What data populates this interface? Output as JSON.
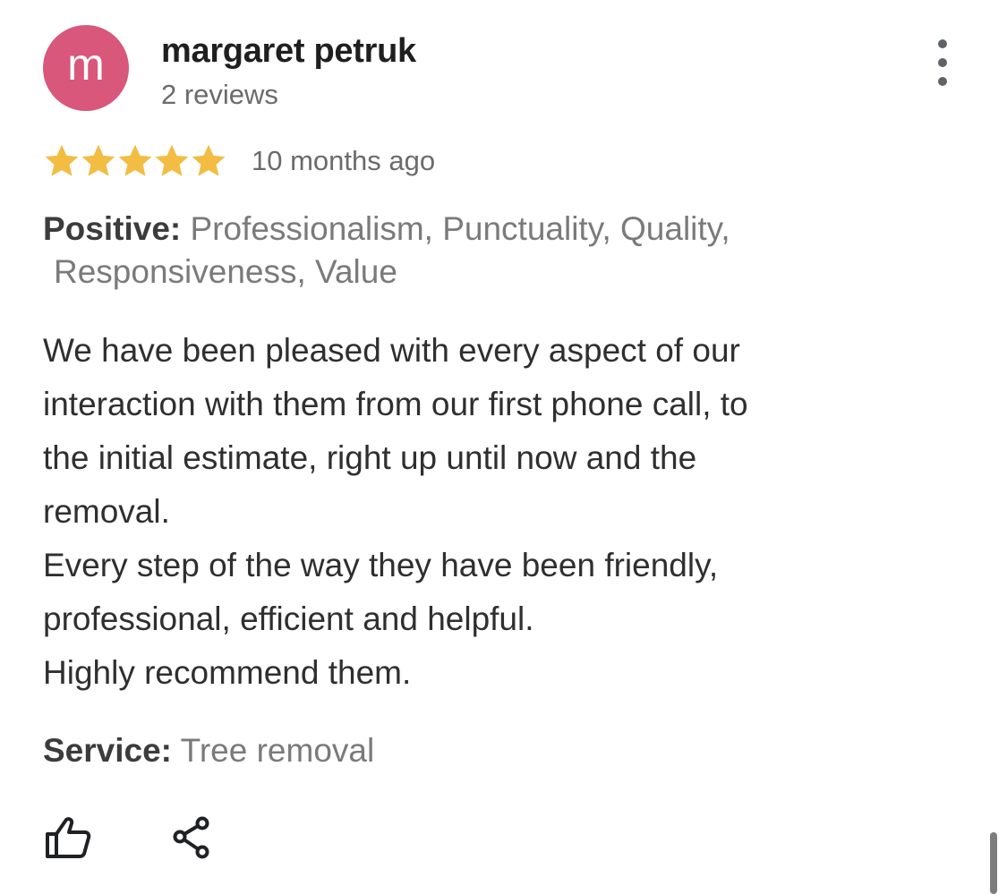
{
  "reviewer": {
    "avatar_letter": "m",
    "avatar_color": "#d8577a",
    "name": "margaret petruk",
    "review_count": "2 reviews"
  },
  "rating": {
    "stars": 5,
    "max_stars": 5,
    "star_color": "#f2bd42",
    "time": "10 months ago"
  },
  "positive": {
    "label": "Positive:",
    "line1": "Professionalism, Punctuality, Quality,",
    "line2": "Responsiveness, Value"
  },
  "body": {
    "lines": [
      "We have been pleased with every aspect of our",
      "interaction with them from our first phone call, to",
      "the initial estimate, right up until now and the",
      "removal.",
      "Every step of the way they have been friendly,",
      "professional, efficient and helpful.",
      "Highly recommend them."
    ]
  },
  "service": {
    "label": "Service:",
    "value": "Tree removal"
  },
  "actions": {
    "like_icon": "thumbs-up-icon",
    "share_icon": "share-icon",
    "more_icon": "more-vert-icon"
  }
}
